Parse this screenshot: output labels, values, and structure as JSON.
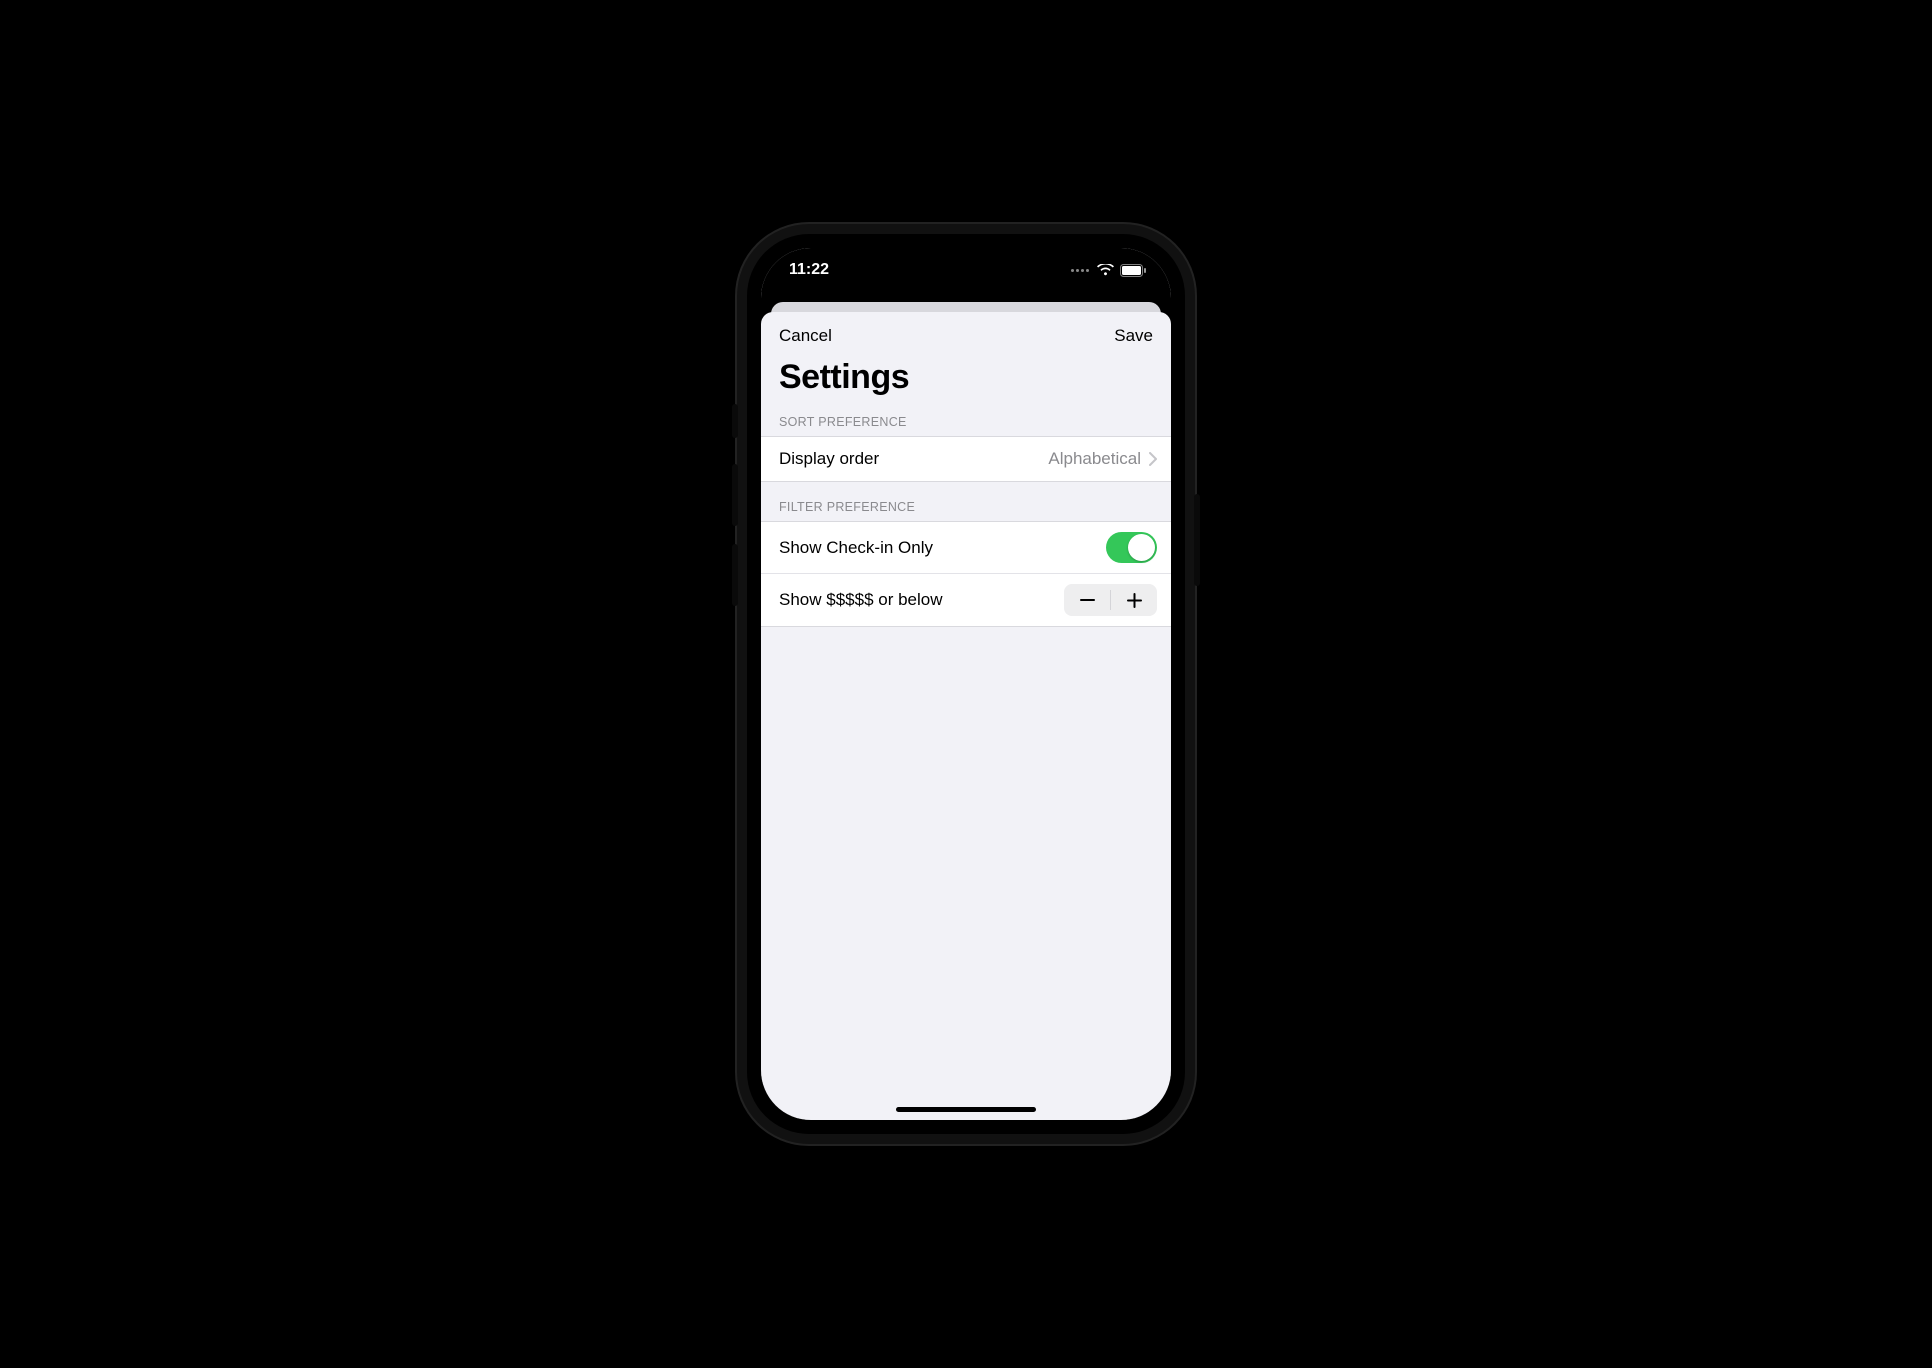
{
  "status": {
    "time": "11:22"
  },
  "nav": {
    "cancel": "Cancel",
    "save": "Save",
    "title": "Settings"
  },
  "sections": {
    "sort": {
      "header": "SORT PREFERENCE",
      "display_order": {
        "label": "Display order",
        "value": "Alphabetical"
      }
    },
    "filter": {
      "header": "FILTER PREFERENCE",
      "checkin": {
        "label": "Show Check-in Only",
        "on": true
      },
      "price": {
        "label": "Show $$$$$ or below"
      }
    }
  }
}
